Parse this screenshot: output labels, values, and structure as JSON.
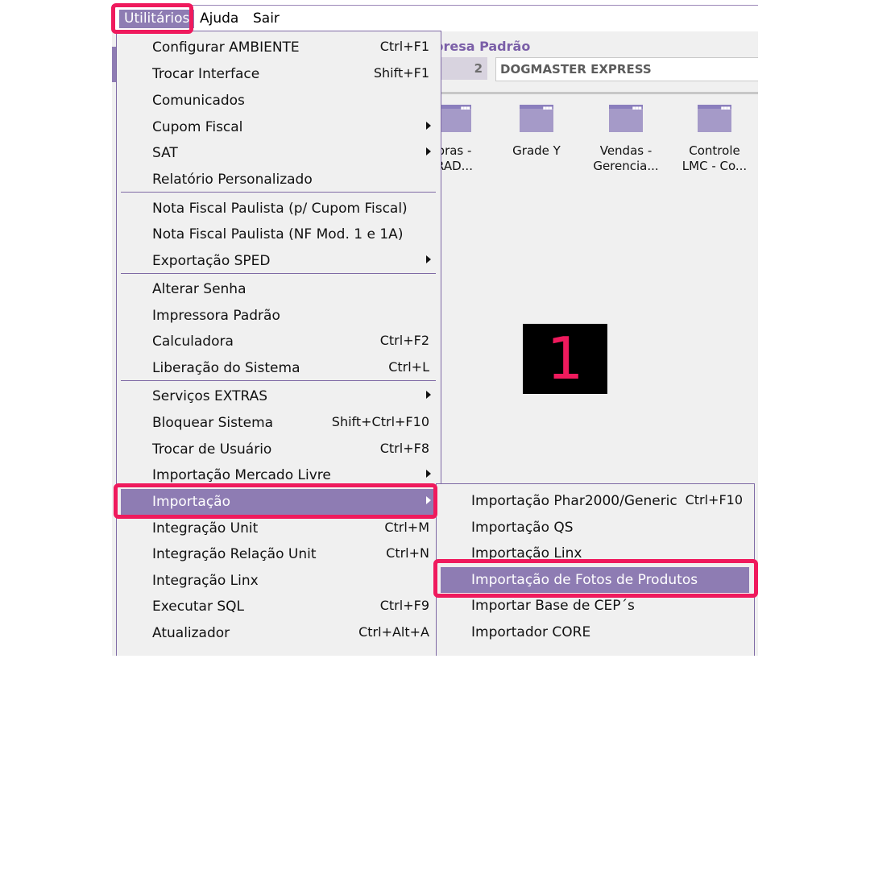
{
  "menubar": {
    "utilitarios": "Utilitários",
    "ajuda": "Ajuda",
    "sair": "Sair"
  },
  "company": {
    "title": "presa Padrão",
    "code": "2",
    "name": "DOGMASTER EXPRESS"
  },
  "shortcuts": [
    {
      "line1": "pras -",
      "line2": "RAD..."
    },
    {
      "line1": "Grade Y",
      "line2": ""
    },
    {
      "line1": "Vendas -",
      "line2": "Gerencia..."
    },
    {
      "line1": "Controle",
      "line2": "LMC - Co..."
    }
  ],
  "menu": {
    "configurar": {
      "label": "Configurar AMBIENTE",
      "shortcut": "Ctrl+F1"
    },
    "trocar_interface": {
      "label": "Trocar Interface",
      "shortcut": "Shift+F1"
    },
    "comunicados": {
      "label": "Comunicados"
    },
    "cupom_fiscal": {
      "label": "Cupom Fiscal"
    },
    "sat": {
      "label": "SAT"
    },
    "relatorio": {
      "label": "Relatório Personalizado"
    },
    "nfp_cupom": {
      "label": "Nota Fiscal Paulista (p/ Cupom Fiscal)"
    },
    "nfp_mod": {
      "label": "Nota Fiscal Paulista (NF Mod. 1 e 1A)"
    },
    "sped": {
      "label": "Exportação SPED"
    },
    "alterar_senha": {
      "label": "Alterar Senha"
    },
    "impressora": {
      "label": "Impressora Padrão"
    },
    "calculadora": {
      "label": "Calculadora",
      "shortcut": "Ctrl+F2"
    },
    "liberacao": {
      "label": "Liberação do Sistema",
      "shortcut": "Ctrl+L"
    },
    "servicos": {
      "label": "Serviços EXTRAS"
    },
    "bloquear": {
      "label": "Bloquear Sistema",
      "shortcut": "Shift+Ctrl+F10"
    },
    "trocar_usuario": {
      "label": "Trocar de Usuário",
      "shortcut": "Ctrl+F8"
    },
    "mercado_livre": {
      "label": "Importação Mercado Livre"
    },
    "importacao": {
      "label": "Importação"
    },
    "integracao_unit": {
      "label": "Integração Unit",
      "shortcut": "Ctrl+M"
    },
    "integracao_rel": {
      "label": "Integração Relação Unit",
      "shortcut": "Ctrl+N"
    },
    "integracao_linx": {
      "label": "Integração Linx"
    },
    "executar_sql": {
      "label": "Executar SQL",
      "shortcut": "Ctrl+F9"
    },
    "atualizador": {
      "label": "Atualizador",
      "shortcut": "Ctrl+Alt+A"
    }
  },
  "submenu": {
    "phar": {
      "label": "Importação Phar2000/Generic",
      "shortcut": "Ctrl+F10"
    },
    "qs": {
      "label": "Importação QS"
    },
    "linx": {
      "label": "Importação Linx"
    },
    "fotos": {
      "label": "Importação de Fotos de Produtos"
    },
    "cep": {
      "label": "Importar Base de CEP´s"
    },
    "core": {
      "label": "Importador CORE"
    }
  },
  "step_badge": "1",
  "colors": {
    "menu_highlight": "#8e7cb3",
    "callout": "#ef1a5d",
    "accent": "#7b5fa8"
  }
}
